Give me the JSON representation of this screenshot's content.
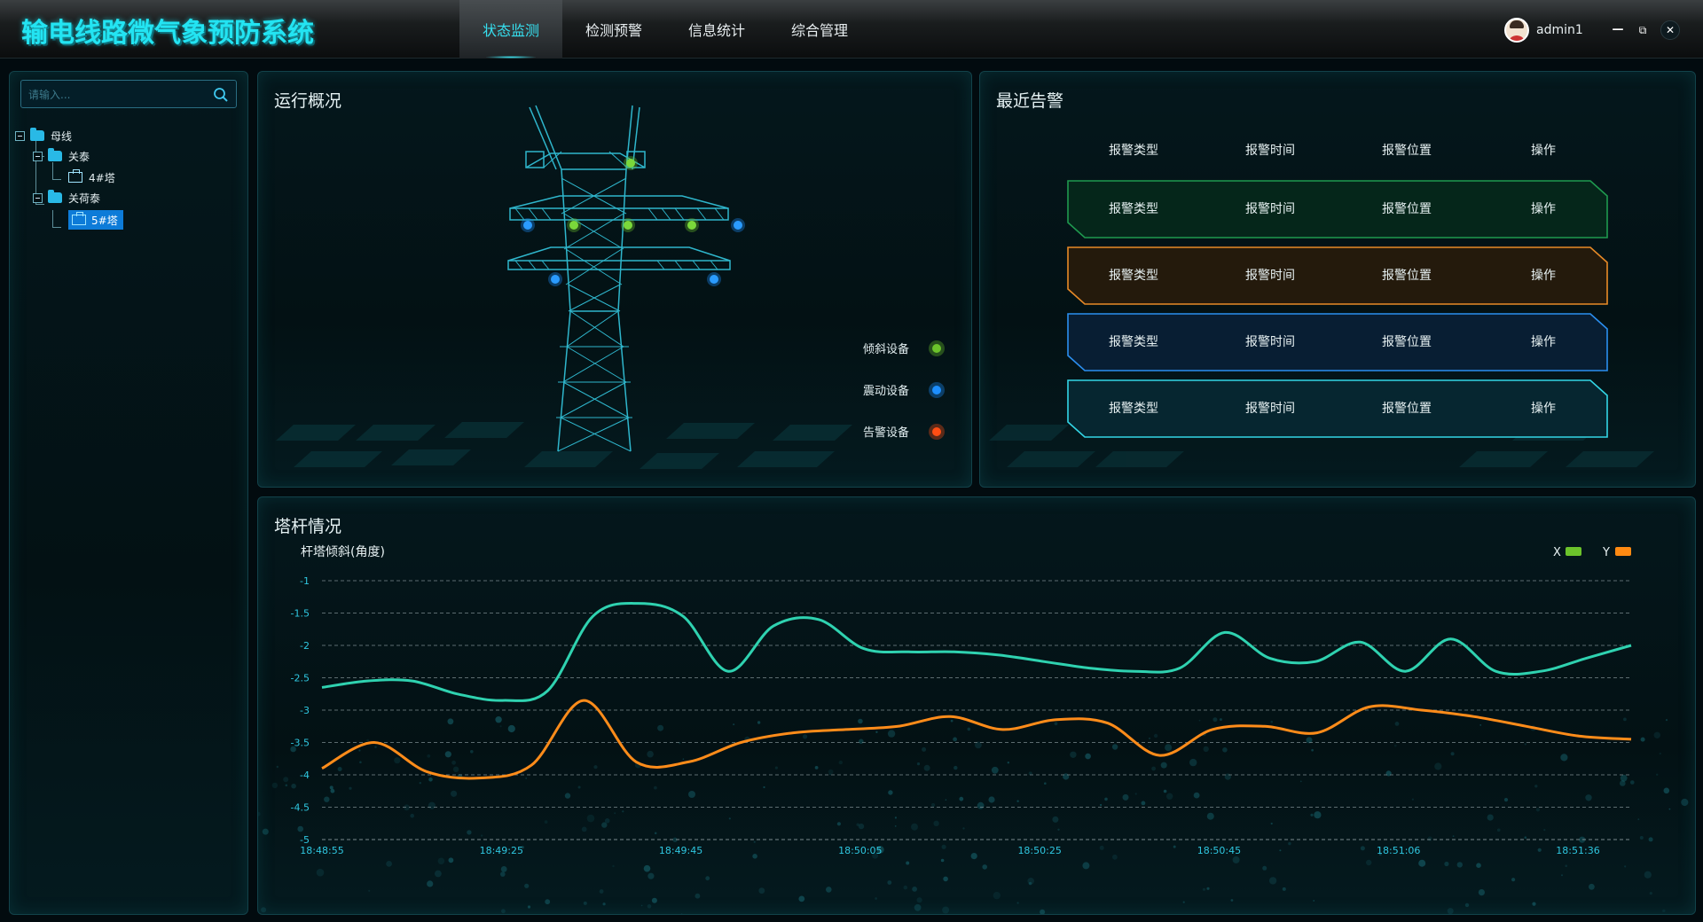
{
  "header": {
    "logo": "输电线路微气象预防系统",
    "nav": [
      "状态监测",
      "检测预警",
      "信息统计",
      "综合管理"
    ],
    "active_nav": 0,
    "username": "admin1",
    "min_glyph": "—",
    "max_glyph": "⧉",
    "close_glyph": "✕"
  },
  "sidebar": {
    "search_placeholder": "请输入...",
    "tree": [
      {
        "label": "母线",
        "level": 0,
        "type": "folder"
      },
      {
        "label": "关泰",
        "level": 1,
        "type": "folder"
      },
      {
        "label": "4#塔",
        "level": 2,
        "type": "tower"
      },
      {
        "label": "关荷泰",
        "level": 1,
        "type": "folder"
      },
      {
        "label": "5#塔",
        "level": 2,
        "type": "tower",
        "selected": true
      }
    ]
  },
  "overview": {
    "title": "运行概况",
    "legend": [
      {
        "label": "倾斜设备",
        "color": "#6cc32b"
      },
      {
        "label": "震动设备",
        "color": "#1d8fff"
      },
      {
        "label": "告警设备",
        "color": "#ff4e14"
      }
    ]
  },
  "alarms": {
    "title": "最近告警",
    "columns": [
      "报警类型",
      "报警时间",
      "报警位置",
      "操作"
    ],
    "rows": [
      {
        "cells": [
          "报警类型",
          "报警时间",
          "报警位置",
          "操作"
        ],
        "color": "#1f9a4f",
        "fill": "#05261a"
      },
      {
        "cells": [
          "报警类型",
          "报警时间",
          "报警位置",
          "操作"
        ],
        "color": "#e88a27",
        "fill": "#241a0c"
      },
      {
        "cells": [
          "报警类型",
          "报警时间",
          "报警位置",
          "操作"
        ],
        "color": "#2b8ff0",
        "fill": "#081e33"
      },
      {
        "cells": [
          "报警类型",
          "报警时间",
          "报警位置",
          "操作"
        ],
        "color": "#33d6e6",
        "fill": "#062630"
      }
    ]
  },
  "towers": {
    "title": "塔杆情况",
    "chart_data": {
      "type": "line",
      "title": "杆塔倾斜(角度)",
      "ylim": [
        -5,
        -1
      ],
      "yticks": [
        -1,
        -1.5,
        -2,
        -2.5,
        -3,
        -3.5,
        -4,
        -4.5,
        -5
      ],
      "xticks": [
        "18:48:55",
        "18:49:25",
        "18:49:45",
        "18:50:05",
        "18:50:25",
        "18:50:45",
        "18:51:06",
        "18:51:36"
      ],
      "x": [
        0,
        0.5,
        1,
        1.5,
        2,
        2.5,
        3,
        3.5,
        4,
        4.5,
        5,
        5.5,
        6,
        6.5,
        7,
        7.5,
        8,
        8.5,
        9,
        9.5,
        10,
        10.5,
        11,
        11.5,
        12,
        12.5,
        13,
        13.5,
        14,
        14.5
      ],
      "series": [
        {
          "name": "X",
          "color": "#6cc32b",
          "line_color": "#2fd2b0",
          "values": [
            -2.65,
            -2.55,
            -2.55,
            -2.75,
            -2.85,
            -2.7,
            -1.55,
            -1.35,
            -1.55,
            -2.4,
            -1.7,
            -1.6,
            -2.05,
            -2.1,
            -2.1,
            -2.15,
            -2.25,
            -2.35,
            -2.4,
            -2.35,
            -1.8,
            -2.2,
            -2.25,
            -1.95,
            -2.4,
            -1.9,
            -2.4,
            -2.4,
            -2.2,
            -2.0
          ]
        },
        {
          "name": "Y",
          "color": "#ff8a12",
          "line_color": "#ff8c1a",
          "values": [
            -3.9,
            -3.5,
            -3.95,
            -4.05,
            -3.85,
            -2.85,
            -3.8,
            -3.8,
            -3.5,
            -3.35,
            -3.3,
            -3.25,
            -3.1,
            -3.3,
            -3.15,
            -3.2,
            -3.7,
            -3.3,
            -3.25,
            -3.35,
            -2.95,
            -3.0,
            -3.1,
            -3.25,
            -3.4,
            -3.45
          ]
        }
      ]
    }
  }
}
